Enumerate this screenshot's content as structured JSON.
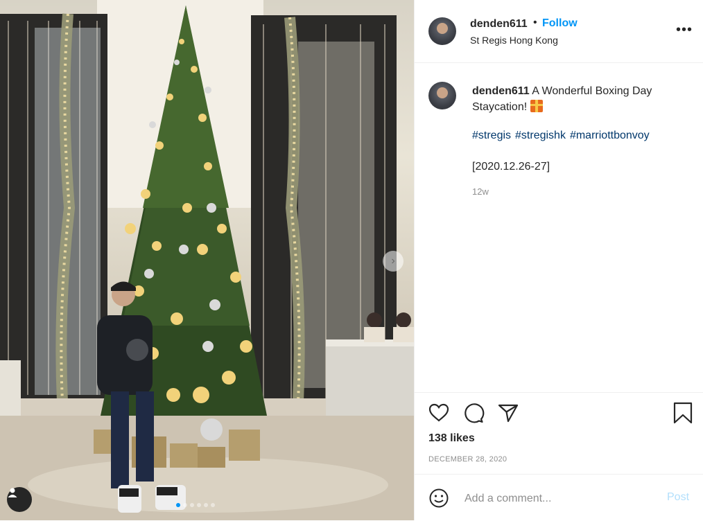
{
  "post": {
    "username": "denden611",
    "separator": "•",
    "follow_label": "Follow",
    "location": "St Regis Hong Kong",
    "more_label": "•••"
  },
  "caption": {
    "username": "denden611",
    "text_line": "A Wonderful Boxing Day Staycation!",
    "gift_emoji_icon": "wrapped-gift-icon",
    "hashtags": [
      "#stregis",
      "#stregishk",
      "#marriottbonvoy"
    ],
    "date_range": "[2020.12.26-27]",
    "age": "12w"
  },
  "stats": {
    "likes": "138 likes",
    "date": "DECEMBER 28, 2020"
  },
  "comment_box": {
    "placeholder": "Add a comment...",
    "post_label": "Post"
  },
  "carousel": {
    "slide_count": 6,
    "active_index": 0,
    "next_icon": "chevron-right-icon"
  },
  "colors": {
    "accent": "#0095f6",
    "hashtag": "#00376b",
    "muted": "#8e8e8e",
    "post_disabled": "#b2dffc"
  }
}
